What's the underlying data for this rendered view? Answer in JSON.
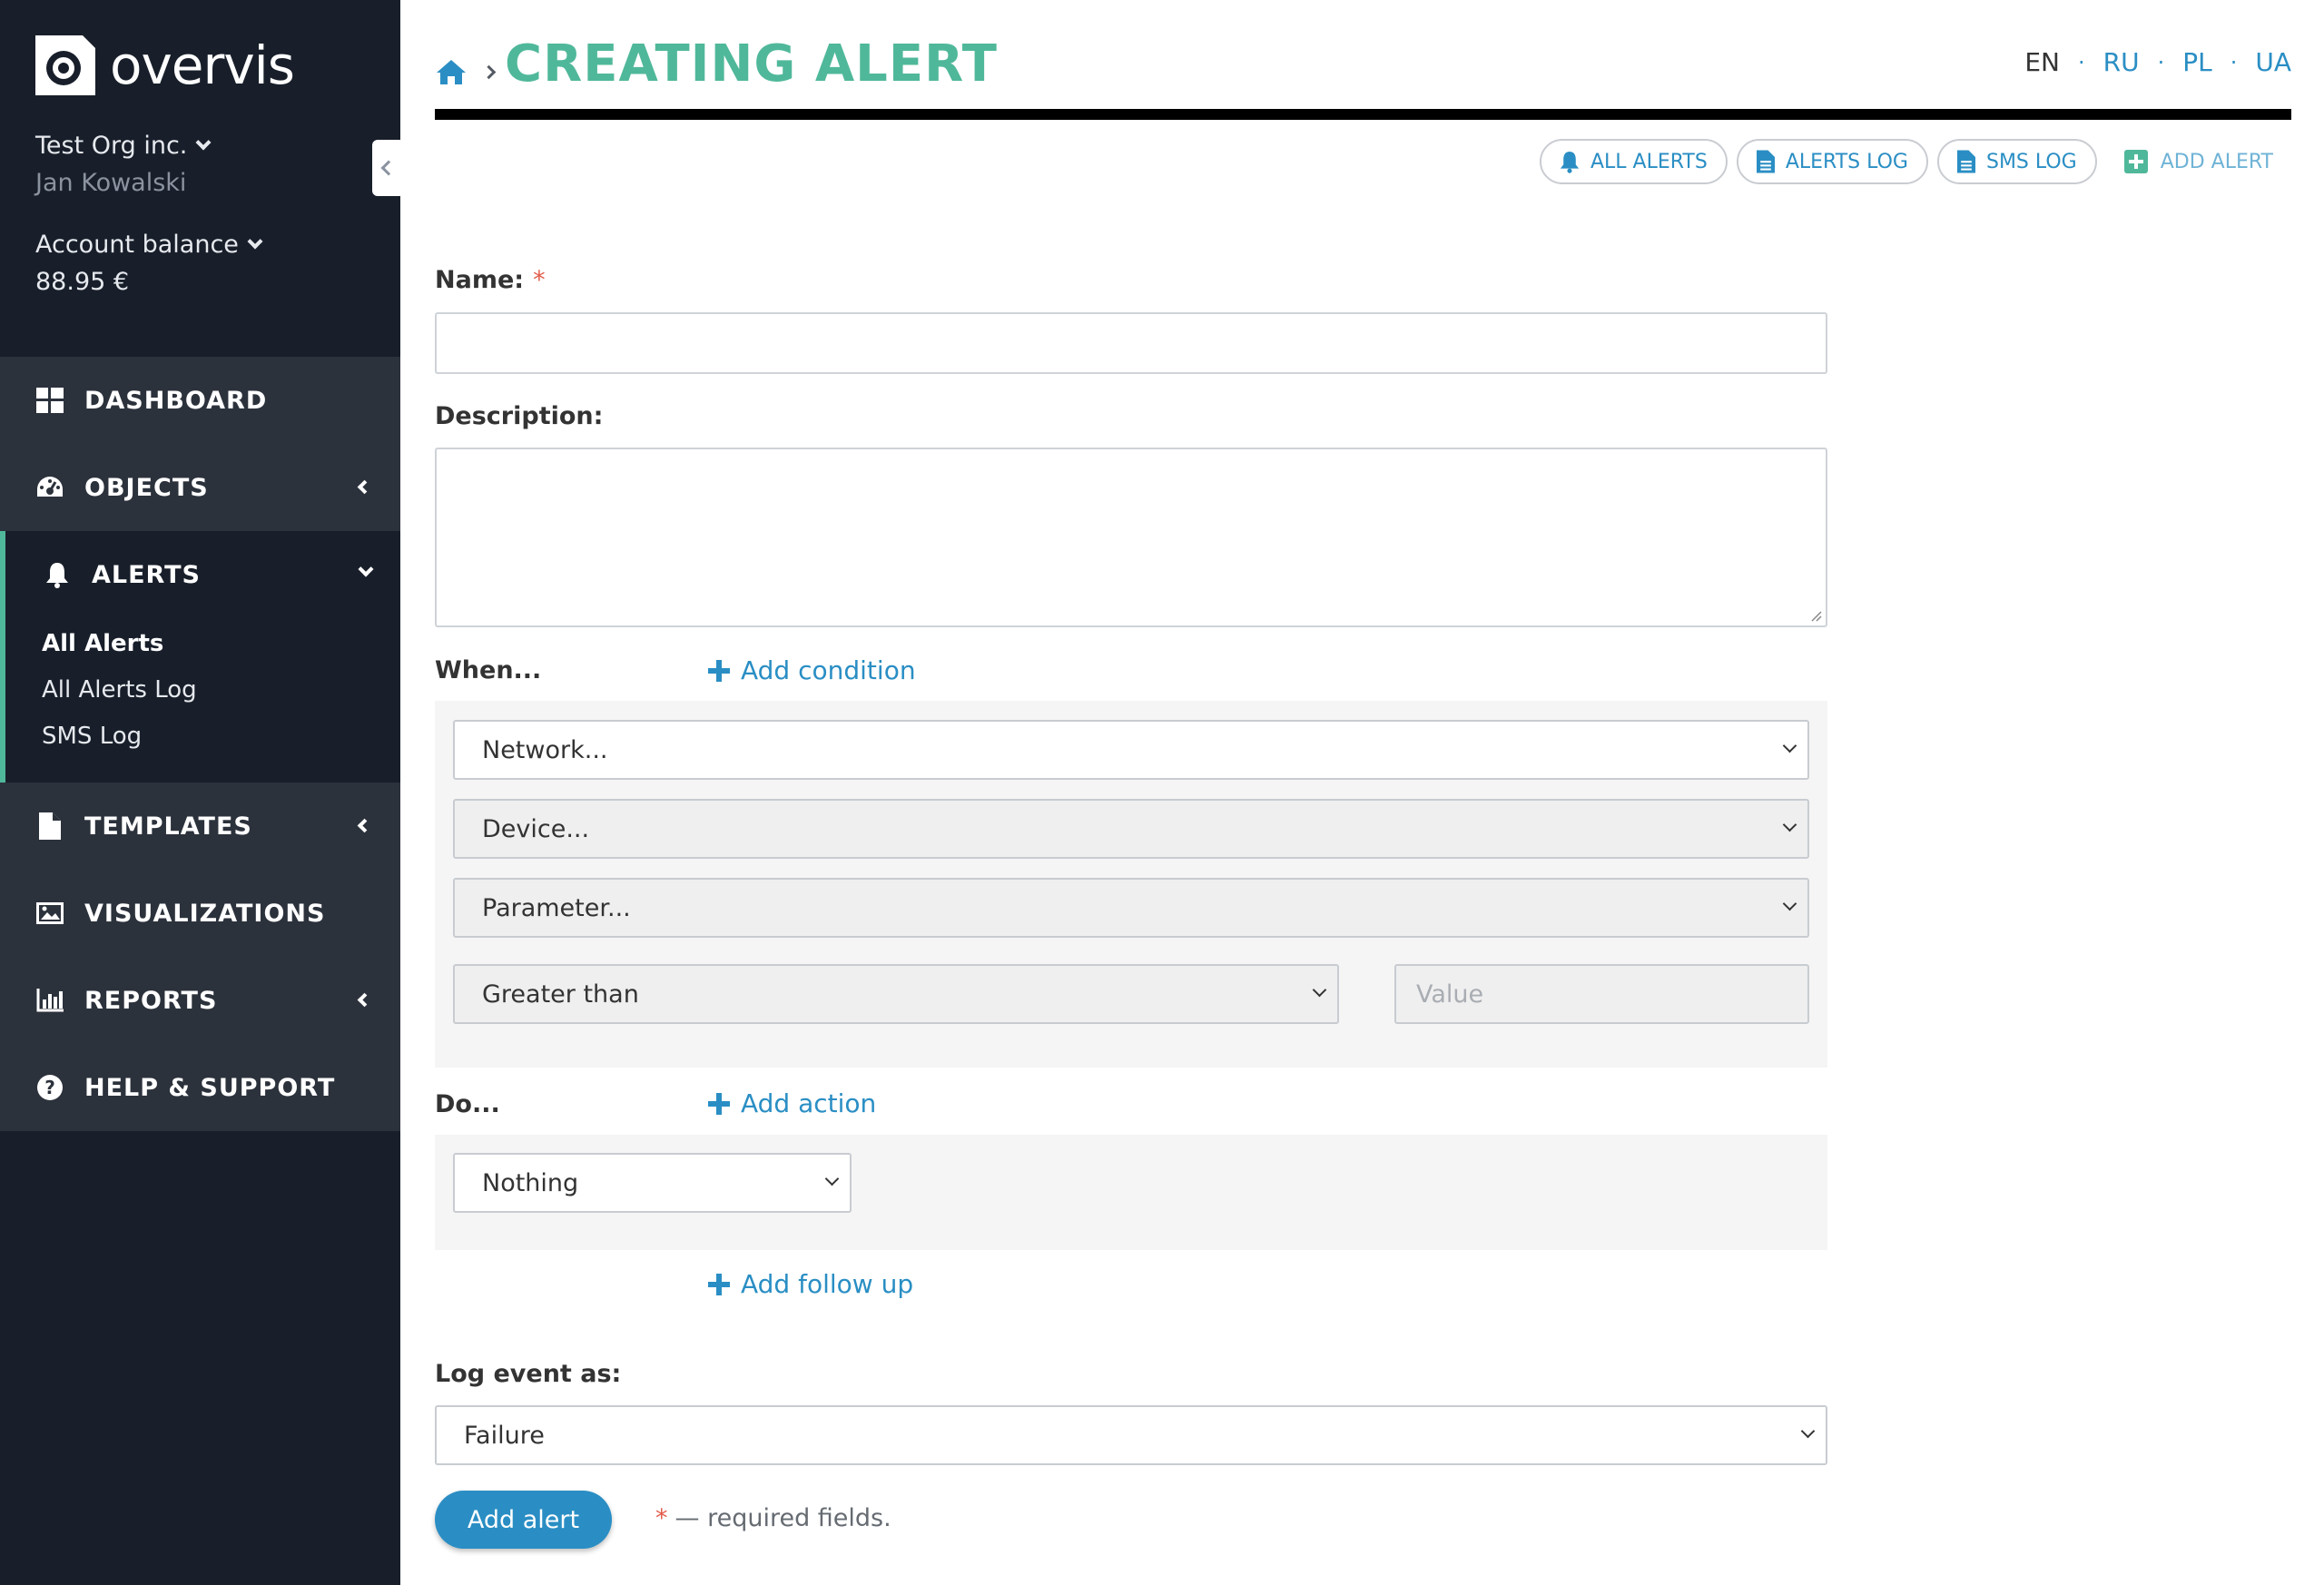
{
  "brand": {
    "name": "overvis"
  },
  "account": {
    "org_name": "Test Org inc.",
    "user_name": "Jan Kowalski",
    "balance_label": "Account balance",
    "balance_value": "88.95 €"
  },
  "nav": {
    "items": [
      {
        "label": "DASHBOARD",
        "icon": "dashboard-icon"
      },
      {
        "label": "OBJECTS",
        "icon": "gauge-icon"
      },
      {
        "label": "ALERTS",
        "icon": "bell-icon"
      },
      {
        "label": "TEMPLATES",
        "icon": "file-icon"
      },
      {
        "label": "VISUALIZATIONS",
        "icon": "image-icon"
      },
      {
        "label": "REPORTS",
        "icon": "bar-chart-icon"
      },
      {
        "label": "HELP & SUPPORT",
        "icon": "question-circle-icon"
      }
    ],
    "alerts_sub": [
      "All Alerts",
      "All Alerts Log",
      "SMS Log"
    ]
  },
  "header": {
    "title": "CREATING ALERT",
    "languages": [
      "EN",
      "RU",
      "PL",
      "UA"
    ],
    "current_language": "EN"
  },
  "toolbar": {
    "all_alerts": "ALL ALERTS",
    "alerts_log": "ALERTS LOG",
    "sms_log": "SMS LOG",
    "add_alert": "ADD ALERT"
  },
  "form": {
    "name_label": "Name:",
    "required_mark": "*",
    "description_label": "Description:",
    "when_label": "When...",
    "add_condition": "Add condition",
    "condition": {
      "network": "Network...",
      "device": "Device...",
      "parameter": "Parameter...",
      "operator": "Greater than",
      "value_placeholder": "Value"
    },
    "do_label": "Do...",
    "add_action": "Add action",
    "action_value": "Nothing",
    "add_follow_up": "Add follow up",
    "log_label": "Log event as:",
    "log_value": "Failure",
    "submit": "Add alert",
    "required_note": "— required fields."
  },
  "colors": {
    "sidebar_bg": "#181f2a",
    "nav_bg": "#2c323c",
    "accent_green": "#50b89a",
    "link_blue": "#2a8ec4",
    "required_red": "#e25c4a"
  }
}
